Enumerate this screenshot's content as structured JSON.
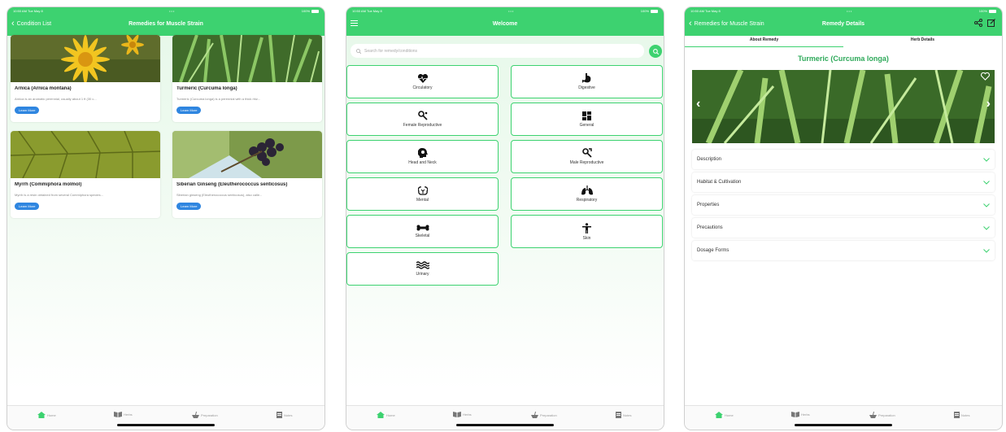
{
  "status": {
    "time": "10:50 AM  Tue May 8",
    "dots": "•••",
    "battery": "100%"
  },
  "screen1": {
    "back_label": "Condition List",
    "title": "Remedies for Muscle Strain",
    "cards": [
      {
        "title": "Arnica (Arnica montana)",
        "desc": "Arnica is an aromatic perennial, usually about 1 ft (30 c...",
        "button": "Learn More"
      },
      {
        "title": "Turmeric (Curcuma longa)",
        "desc": "Turmeric (Curcuma longa) is a perennial with a thick rhiz...",
        "button": "Learn More"
      },
      {
        "title": "Myrrh (Commiphora molmol)",
        "desc": "Myrrh is a resin obtained from several Commiphora species...",
        "button": "Learn More"
      },
      {
        "title": "Siberian Ginseng (Eleutherococcus senticosus)",
        "desc": "Siberian ginseng (Eleutherococcus senticosus), also calle...",
        "button": "Learn More"
      }
    ]
  },
  "screen2": {
    "title": "Welcome",
    "search_placeholder": "Search for remedy/conditions",
    "categories": [
      {
        "label": "Circulatory",
        "icon": "heart-pulse-icon"
      },
      {
        "label": "Digestive",
        "icon": "stomach-icon"
      },
      {
        "label": "Female Reproductive",
        "icon": "female-reproductive-icon"
      },
      {
        "label": "General",
        "icon": "grid-icon"
      },
      {
        "label": "Head and Neck",
        "icon": "head-icon"
      },
      {
        "label": "Male Reproductive",
        "icon": "male-reproductive-icon"
      },
      {
        "label": "Mental",
        "icon": "brain-icon"
      },
      {
        "label": "Respiratory",
        "icon": "lungs-icon"
      },
      {
        "label": "Skeletal",
        "icon": "bone-icon"
      },
      {
        "label": "Skin",
        "icon": "person-icon"
      },
      {
        "label": "Urinary",
        "icon": "water-icon"
      }
    ]
  },
  "screen3": {
    "back_label": "Remedies for Muscle Strain",
    "title": "Remedy Details",
    "tabs": [
      "About Remedy",
      "Herb Details"
    ],
    "herb_title": "Turmeric (Curcuma longa)",
    "sections": [
      "Description",
      "Habitat & Cultivation",
      "Properties",
      "Precautions",
      "Dosage Forms"
    ]
  },
  "tabbar": [
    "Home",
    "Herbs",
    "Preparation",
    "Notes"
  ],
  "colors": {
    "accent": "#3dd270",
    "button": "#2f86e0",
    "title_green": "#2ea95a"
  }
}
